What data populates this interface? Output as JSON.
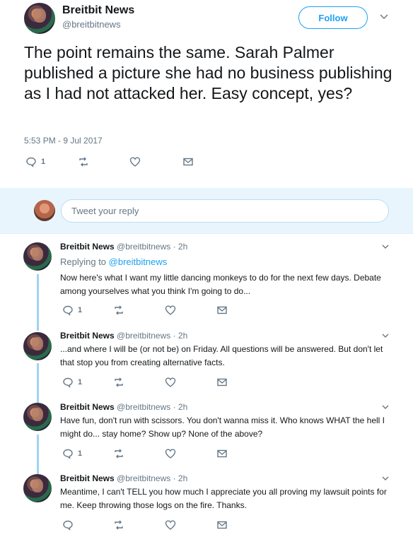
{
  "main_tweet": {
    "display_name": "Breitbit News",
    "handle": "@breitbitnews",
    "follow_label": "Follow",
    "text": "The point remains the same. Sarah Palmer published a picture she had no business publishing as I had not attacked her. Easy concept, yes?",
    "timestamp": "5:53 PM - 9 Jul 2017",
    "reply_count": "1"
  },
  "reply_box": {
    "placeholder": "Tweet your reply"
  },
  "replies": [
    {
      "name": "Breitbit News",
      "meta": "@breitbitnews · 2h",
      "replying_prefix": "Replying to",
      "replying_handle": "@breitbitnews",
      "text": "Now here's what I want my little dancing monkeys to do for the next few days. Debate among yourselves what you think I'm going to do...",
      "reply_count": "1"
    },
    {
      "name": "Breitbit News",
      "meta": "@breitbitnews · 2h",
      "text": "...and where I will be (or not be) on Friday. All questions will be answered. But don't let that stop you from creating alternative facts.",
      "reply_count": "1"
    },
    {
      "name": "Breitbit News",
      "meta": "@breitbitnews · 2h",
      "text": "Have fun, don't run with scissors. You don't wanna miss it. Who knows WHAT the hell I might do... stay home? Show up? None of the above?",
      "reply_count": "1"
    },
    {
      "name": "Breitbit News",
      "meta": "@breitbitnews · 2h",
      "text": "Meantime, I can't TELL you how much I appreciate you all proving my lawsuit points for me. Keep throwing those logs on the fire. Thanks.",
      "reply_count": ""
    }
  ],
  "icons": {
    "reply": "reply-icon",
    "retweet": "retweet-icon",
    "like": "heart-icon",
    "dm": "envelope-icon",
    "caret": "chevron-down-icon"
  },
  "colors": {
    "accent": "#1da1f2",
    "secondary_text": "#657786",
    "reply_bar_bg": "#e8f5fd",
    "thread_line": "#9fd3f4"
  }
}
